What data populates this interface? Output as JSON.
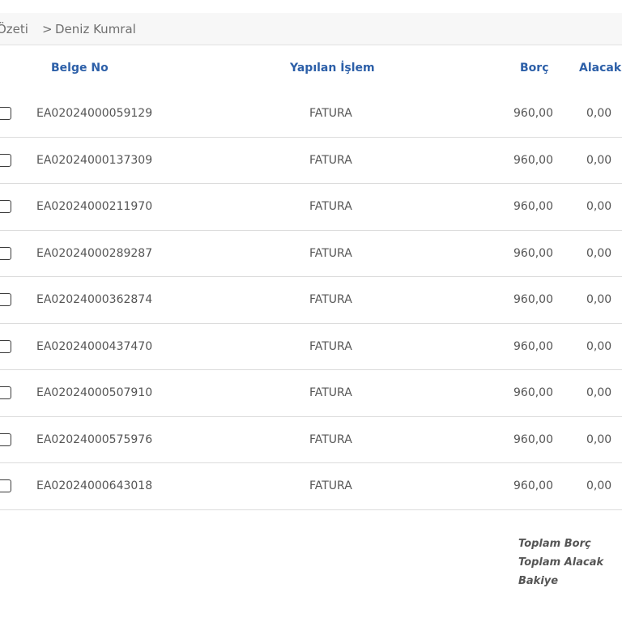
{
  "breadcrumb": {
    "prev": "Özeti",
    "separator": ">",
    "current": "Deniz Kumral"
  },
  "table": {
    "headers": {
      "belge_no": "Belge No",
      "yapilan_islem": "Yapılan İşlem",
      "borc": "Borç",
      "alacak": "Alacak"
    },
    "rows": [
      {
        "belge_no": "EA02024000059129",
        "islem": "FATURA",
        "borc": "960,00",
        "alacak": "0,00"
      },
      {
        "belge_no": "EA02024000137309",
        "islem": "FATURA",
        "borc": "960,00",
        "alacak": "0,00"
      },
      {
        "belge_no": "EA02024000211970",
        "islem": "FATURA",
        "borc": "960,00",
        "alacak": "0,00"
      },
      {
        "belge_no": "EA02024000289287",
        "islem": "FATURA",
        "borc": "960,00",
        "alacak": "0,00"
      },
      {
        "belge_no": "EA02024000362874",
        "islem": "FATURA",
        "borc": "960,00",
        "alacak": "0,00"
      },
      {
        "belge_no": "EA02024000437470",
        "islem": "FATURA",
        "borc": "960,00",
        "alacak": "0,00"
      },
      {
        "belge_no": "EA02024000507910",
        "islem": "FATURA",
        "borc": "960,00",
        "alacak": "0,00"
      },
      {
        "belge_no": "EA02024000575976",
        "islem": "FATURA",
        "borc": "960,00",
        "alacak": "0,00"
      },
      {
        "belge_no": "EA02024000643018",
        "islem": "FATURA",
        "borc": "960,00",
        "alacak": "0,00"
      }
    ]
  },
  "totals": {
    "toplam_borc": "Toplam Borç",
    "toplam_alacak": "Toplam Alacak",
    "bakiye": "Bakiye"
  },
  "colors": {
    "header_text": "#2c5fa8",
    "body_text": "#555555",
    "breadcrumb_bg": "#f7f7f7"
  }
}
